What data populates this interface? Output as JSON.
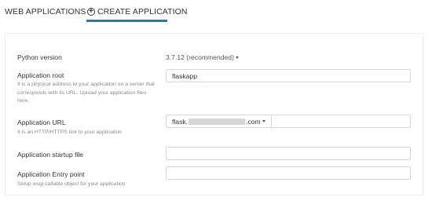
{
  "tabs": {
    "web_applications": "WEB APPLICATIONS",
    "create_application": "CREATE APPLICATION"
  },
  "form": {
    "python_version": {
      "label": "Python version",
      "value": "3.7.12 (recommended)"
    },
    "application_root": {
      "label": "Application root",
      "help": "It is a physical address to your application on a server that corresponds with its URL. Upload your application files here.",
      "value": "flaskapp"
    },
    "application_url": {
      "label": "Application URL",
      "help": "It is an HTTP/HTTPS link to your application",
      "domain_prefix": "flask.",
      "domain_suffix": ".com",
      "path_value": ""
    },
    "startup_file": {
      "label": "Application startup file",
      "value": ""
    },
    "entry_point": {
      "label": "Application Entry point",
      "help": "Setup wsgi callable object for your application",
      "value": ""
    }
  },
  "colors": {
    "accent": "#1f7ea8"
  }
}
